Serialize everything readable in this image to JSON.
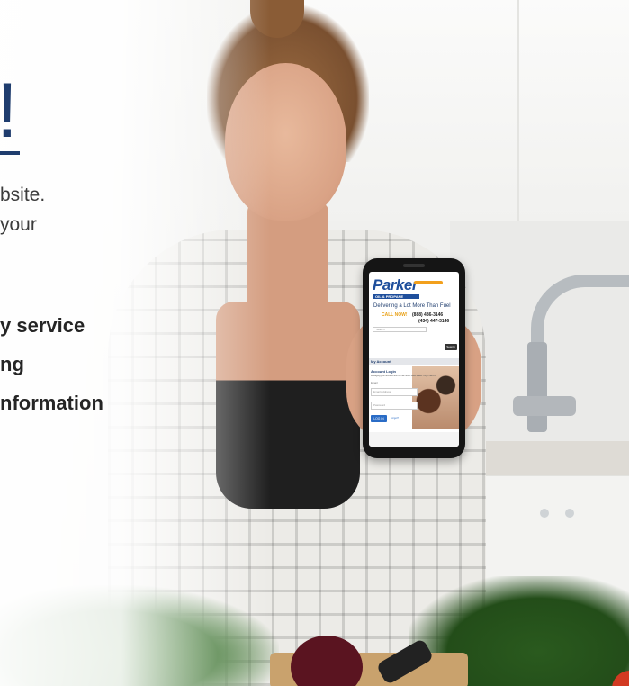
{
  "left": {
    "headline_mark": "!",
    "intro_lines": [
      "bsite.",
      "your"
    ],
    "features": [
      "y service",
      "ng",
      "nformation"
    ]
  },
  "phone_screen": {
    "logo": {
      "name": "Parker",
      "sub": "OIL & PROPANE"
    },
    "tagline": "Delivering a Lot More Than Fuel",
    "call_label": "CALL NOW!",
    "phone_1": "(888) 486-3146",
    "phone_2": "(434) 447-3146",
    "search_placeholder": "Search",
    "search_button": "Search",
    "my_account": "My Account",
    "login_title": "Account Login",
    "login_desc": "Managing your account with us has never been easier. Login here or register.",
    "email_label": "Email",
    "email_placeholder": "Email Address",
    "password_placeholder": "Password",
    "login_button": "LOG IN",
    "forgot_link": "Forgot?"
  },
  "colors": {
    "brand_blue": "#1f3d6e",
    "accent_orange": "#f2a01c",
    "button_blue": "#2a6cc6"
  }
}
